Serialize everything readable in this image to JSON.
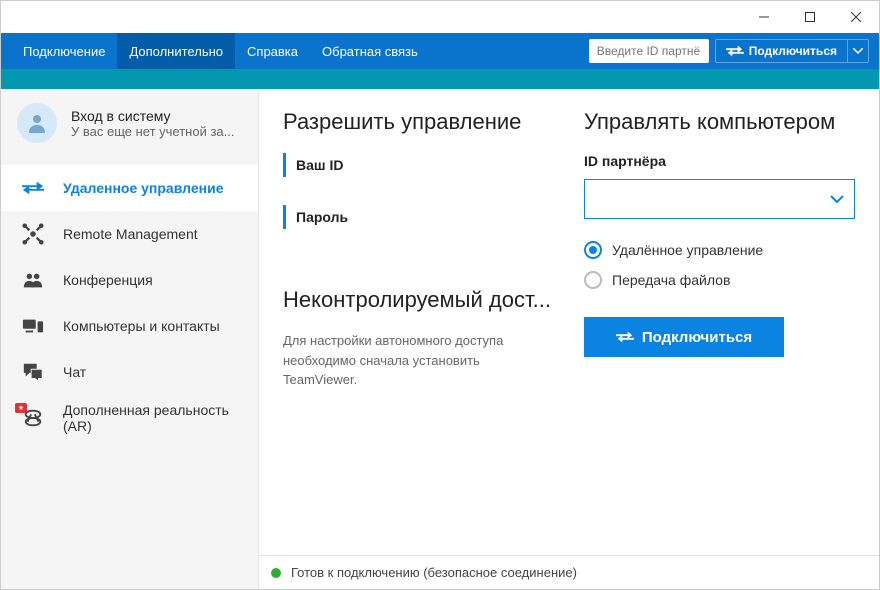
{
  "menubar": {
    "items": [
      "Подключение",
      "Дополнительно",
      "Справка",
      "Обратная связь"
    ],
    "active_index": 1,
    "partner_placeholder": "Введите ID партнёр",
    "connect_label": "Подключиться"
  },
  "account": {
    "title": "Вход в систему",
    "subtitle": "У вас еще нет учетной за..."
  },
  "sidebar": {
    "items": [
      {
        "label": "Удаленное управление",
        "icon": "arrows"
      },
      {
        "label": "Remote Management",
        "icon": "monitor-arrows"
      },
      {
        "label": "Конференция",
        "icon": "people"
      },
      {
        "label": "Компьютеры и контакты",
        "icon": "devices"
      },
      {
        "label": "Чат",
        "icon": "chat"
      },
      {
        "label": "Дополненная реальность (AR)",
        "icon": "ar",
        "badge": true
      }
    ],
    "active_index": 0
  },
  "allow": {
    "title": "Разрешить управление",
    "id_label": "Ваш ID",
    "password_label": "Пароль",
    "unattended_title": "Неконтролируемый дост...",
    "unattended_desc": "Для настройки автономного доступа необходимо сначала установить TeamViewer."
  },
  "control": {
    "title": "Управлять компьютером",
    "partner_label": "ID партнёра",
    "partner_value": "",
    "radio_remote": "Удалённое управление",
    "radio_file": "Передача файлов",
    "selected_radio": "remote",
    "connect_label": "Подключиться"
  },
  "status": {
    "text": "Готов к подключению (безопасное соединение)",
    "color": "#2bb02b"
  }
}
